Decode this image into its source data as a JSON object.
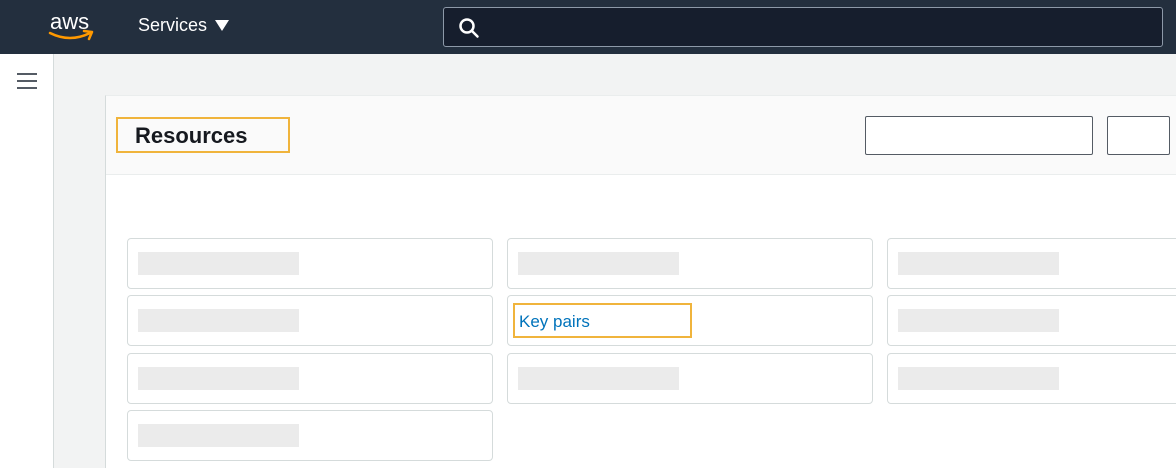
{
  "topbar": {
    "logo_text": "aws",
    "services_label": "Services",
    "search": {
      "value": "",
      "placeholder": ""
    }
  },
  "panel": {
    "title": "Resources"
  },
  "resources": {
    "highlighted_link": "Key pairs"
  },
  "colors": {
    "topbar_bg": "#232f3e",
    "highlight": "#f0b43c",
    "link": "#0073bb"
  }
}
